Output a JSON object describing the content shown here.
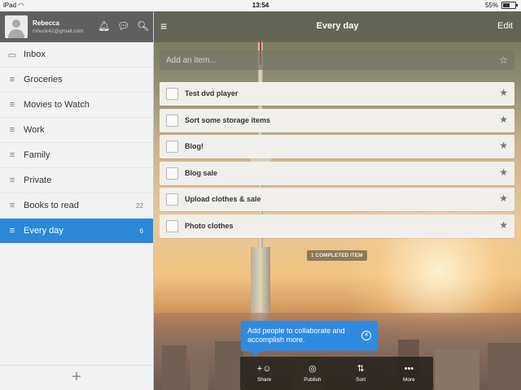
{
  "statusbar": {
    "device": "iPad",
    "wifi_icon": "wifi-icon",
    "time": "13:54",
    "battery": "55%",
    "battery_level": 0.55
  },
  "account": {
    "name": "Rebecca",
    "email": "rshuck42@gmail.com"
  },
  "sidebar": {
    "items": [
      {
        "label": "Inbox",
        "count": "",
        "icon": "inbox-icon"
      },
      {
        "label": "Groceries",
        "count": "",
        "icon": "list-icon"
      },
      {
        "label": "Movies to Watch",
        "count": "",
        "icon": "list-icon"
      },
      {
        "label": "Work",
        "count": "",
        "icon": "list-icon"
      },
      {
        "label": "Family",
        "count": "",
        "icon": "list-icon"
      },
      {
        "label": "Private",
        "count": "",
        "icon": "list-icon"
      },
      {
        "label": "Books to read",
        "count": "22",
        "icon": "list-icon"
      },
      {
        "label": "Every day",
        "count": "6",
        "icon": "list-icon",
        "selected": true
      }
    ],
    "add_label": "+"
  },
  "header": {
    "title": "Every day",
    "edit_label": "Edit"
  },
  "add_item": {
    "placeholder": "Add an item..."
  },
  "tasks": [
    {
      "label": "Test dvd player"
    },
    {
      "label": "Sort some storage items"
    },
    {
      "label": "Blog!"
    },
    {
      "label": "Blog sale"
    },
    {
      "label": "Upload clothes & sale"
    },
    {
      "label": "Photo clothes"
    }
  ],
  "completed_label": "1 COMPLETED ITEM",
  "tooltip": {
    "text": "Add people to collaborate and accomplish more."
  },
  "toolbar": {
    "share": "Share",
    "publish": "Publish",
    "sort": "Sort",
    "more": "More"
  },
  "colors": {
    "accent": "#2b88d8",
    "tooltip": "#2f8be0"
  }
}
